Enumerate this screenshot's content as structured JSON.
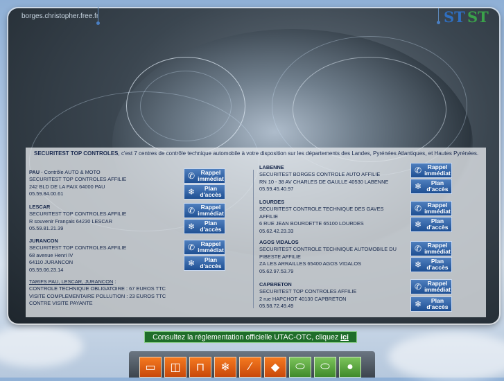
{
  "header": {
    "domain": "borges.christopher.free.fr",
    "logo_left": "ST",
    "logo_right": "ST"
  },
  "intro": {
    "brand": "SECURITEST TOP CONTROLES",
    "text": ", c'est 7 centres de contrôle technique automobile à votre disposition sur les départements des Landes, Pyrénées Atlantiques, et Hautes Pyrénées."
  },
  "buttons": {
    "rappel": "Rappel immédiat",
    "plan": "Plan d'accès"
  },
  "left": {
    "pau": {
      "city": "PAU",
      "type": " - Contrôle AUTO & MOTO",
      "name": "SECURITEST TOP CONTROLES AFFILIE",
      "addr1": "242 BLD DE LA PAIX 64000 PAU",
      "tel": "05.59.84.00.61"
    },
    "lescar": {
      "city": "LESCAR",
      "name": "SECURITEST TOP CONTROLES AFFILIE",
      "addr1": "R souvenir Français 64230 LESCAR",
      "tel": "05.59.81.21.39"
    },
    "jurancon": {
      "city": "JURANCON",
      "name": "SECURITEST TOP CONTROLES AFFILIE",
      "addr1": "68 avenue Henri IV",
      "addr2": "64110 JURANCON",
      "tel": "05.59.06.23.14"
    },
    "tarifs": {
      "title": "TARIFS PAU, LESCAR, JURANCON",
      "sep": " :",
      "l1": "CONTROLE TECHNIQUE OBLIGATOIRE : 67 EUROS TTC",
      "l2": "VISITE COMPLEMENTAIRE POLLUTION : 23 EUROS TTC",
      "l3": "CONTRE VISITE PAYANTE"
    }
  },
  "right": {
    "labenne": {
      "city": "LABENNE",
      "name": "SECURITEST BORGES CONTROLE AUTO AFFILIE",
      "addr1": "RN 10 - 38 AV CHARLES DE GAULLE 40530 LABENNE",
      "tel": "05.59.45.40.97"
    },
    "lourdes": {
      "city": "LOURDES",
      "name": "SECURITEST CONTROLE TECHNIQUE DES GAVES",
      "name2": "AFFILIE",
      "addr1": "6 RUE JEAN BOURDETTE 65100 LOURDES",
      "tel": "05.62.42.23.33"
    },
    "agos": {
      "city": "AGOS VIDALOS",
      "name": "SECURITEST CONTROLE TECHNIQUE AUTOMOBILE DU",
      "name2": "PIBESTE AFFILIE",
      "addr1": "ZA LES ARRAILLES 65400 AGOS VIDALOS",
      "tel": "05.62.97.53.79"
    },
    "capbreton": {
      "city": "CAPBRETON",
      "name": "SECURITEST TOP CONTROLES AFFILIE",
      "addr1": "2 rue HAPCHOT 40130 CAPBRETON",
      "tel": "05.58.72.49.49"
    }
  },
  "reglementation": {
    "text": "Consultez la réglementation officielle UTAC-OTC, cliquez",
    "link": "ici"
  },
  "nav_icons": [
    "book-icon",
    "glasses-icon",
    "document-icon",
    "snowflake-icon",
    "brush-icon",
    "eraser-icon",
    "mouse-icon",
    "mouse-icon",
    "speech-icon"
  ],
  "colors": {
    "accent_blue": "#1e4f93",
    "nav_orange": "#f57a1f",
    "nav_green": "#4e9a33",
    "reg_green": "#1f6e2a"
  }
}
